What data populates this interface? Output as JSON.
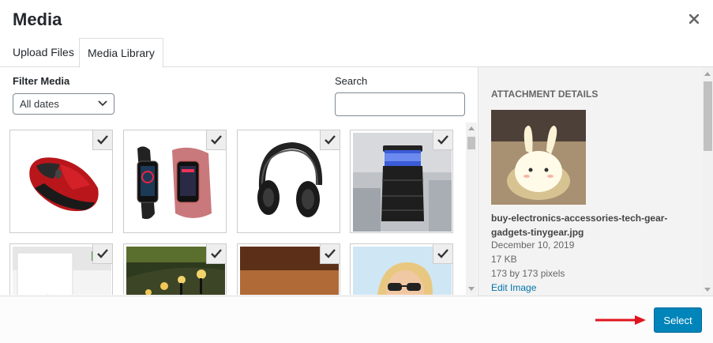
{
  "modal": {
    "title": "Media"
  },
  "tabs": [
    {
      "label": "Upload Files"
    },
    {
      "label": "Media Library"
    }
  ],
  "toolbar": {
    "filter_label": "Filter Media",
    "filter_value": "All dates",
    "search_label": "Search",
    "search_value": ""
  },
  "media_items": [
    {
      "icon": "mouse"
    },
    {
      "icon": "fitness-bands"
    },
    {
      "icon": "headphones"
    },
    {
      "icon": "mosquito-lamp"
    },
    {
      "icon": "earbuds"
    },
    {
      "icon": "garden-lights"
    },
    {
      "icon": "table-lamp"
    },
    {
      "icon": "woman-sunglasses"
    }
  ],
  "details": {
    "heading": "Attachment Details",
    "filename": "buy-electronics-accessories-tech-gear-gadgets-tinygear.jpg",
    "date": "December 10, 2019",
    "size": "17 KB",
    "dimensions": "173 by 173 pixels",
    "edit_link": "Edit Image"
  },
  "footer": {
    "select_label": "Select"
  },
  "colors": {
    "accent": "#0085ba",
    "annotation_arrow": "#e0141e"
  }
}
